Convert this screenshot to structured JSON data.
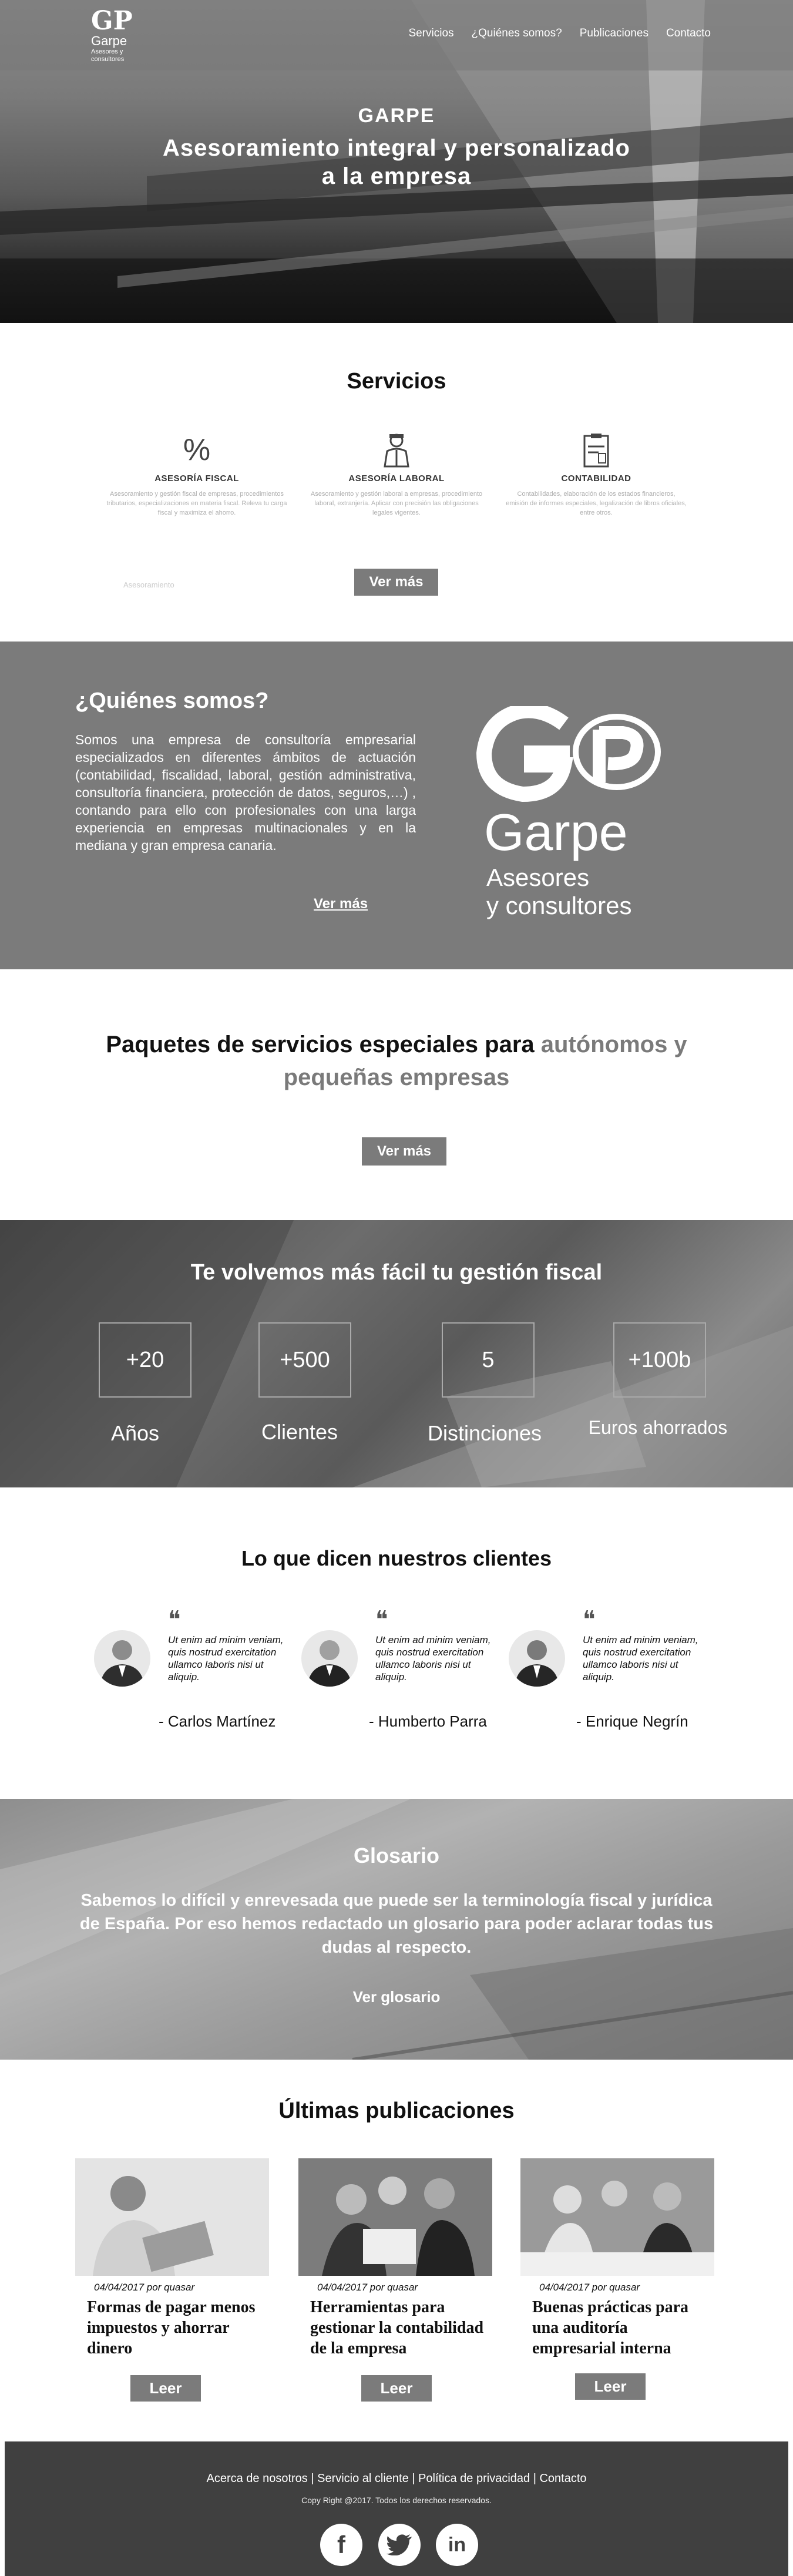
{
  "nav": {
    "logo_mark": "GP",
    "logo_name": "Garpe",
    "logo_sub": "Asesores y consultores",
    "links": [
      "Servicios",
      "¿Quiénes somos?",
      "Publicaciones",
      "Contacto"
    ]
  },
  "hero": {
    "title": "GARPE",
    "subtitle": "Asesoramiento integral y personalizado a la empresa"
  },
  "servicios": {
    "title": "Servicios",
    "items": [
      {
        "icon": "percent-icon",
        "title": "ASESORÍA FISCAL",
        "text": "Asesoramiento y gestión fiscal de empresas, procedimientos tributarios, especializaciones en materia fiscal. Releva tu carga fiscal y maximiza el ahorro."
      },
      {
        "icon": "worker-icon",
        "title": "ASESORÍA LABORAL",
        "text": "Asesoramiento y gestión laboral a empresas, procedimiento laboral, extranjería. Aplicar con precisión las obligaciones legales vigentes."
      },
      {
        "icon": "clipboard-icon",
        "title": "CONTABILIDAD",
        "text": "Contabilidades, elaboración de los estados financieros, emisión de informes especiales, legalización de libros oficiales, entre otros."
      }
    ],
    "faint_label": "Asesoramiento",
    "button": "Ver más"
  },
  "quienes": {
    "title": "¿Quiénes somos?",
    "text": "Somos una empresa de consultoría empresarial especializados en diferentes ámbitos de actuación (contabilidad, fiscalidad, laboral, gestión administrativa, consultoría financiera, protección de datos, seguros,…) , contando para ello con profesionales con una larga experiencia en empresas multinacionales y en la mediana y gran empresa canaria.",
    "link": "Ver más",
    "logo_name": "Garpe",
    "logo_sub_1": "Asesores",
    "logo_sub_2": "y consultores"
  },
  "paquetes": {
    "title_part1": "Paquetes de servicios especiales para ",
    "title_part2": "autónomos y pequeñas empresas",
    "button": "Ver más"
  },
  "fiscal": {
    "title": "Te volvemos más fácil tu gestión fiscal",
    "stats": [
      {
        "value": "+20",
        "label": "Años"
      },
      {
        "value": "+500",
        "label": "Clientes"
      },
      {
        "value": "5",
        "label": "Distinciones"
      },
      {
        "value": "+100b",
        "label": "Euros ahorrados"
      }
    ]
  },
  "testimonios": {
    "title": "Lo que dicen nuestros clientes",
    "items": [
      {
        "quote": "Ut enim ad minim veniam, quis nostrud exercitation ullamco laboris nisi ut aliquip.",
        "name": "- Carlos Martínez"
      },
      {
        "quote": "Ut enim ad minim veniam, quis nostrud exercitation ullamco laboris nisi ut aliquip.",
        "name": "- Humberto Parra"
      },
      {
        "quote": "Ut enim ad minim veniam, quis nostrud exercitation ullamco laboris nisi ut aliquip.",
        "name": "- Enrique Negrín"
      }
    ]
  },
  "glosario": {
    "title": "Glosario",
    "text": "Sabemos lo difícil y enrevesada que puede ser la terminología fiscal y jurídica de España. Por eso hemos redactado un glosario para poder aclarar todas tus dudas al respecto.",
    "link": "Ver glosario"
  },
  "publicaciones": {
    "title": "Últimas publicaciones",
    "items": [
      {
        "meta": "04/04/2017 por quasar",
        "title": "Formas de pagar menos impuestos y ahorrar dinero",
        "button": "Leer"
      },
      {
        "meta": "04/04/2017 por quasar",
        "title": "Herramientas para gestionar la contabilidad de la empresa",
        "button": "Leer"
      },
      {
        "meta": "04/04/2017 por quasar",
        "title": "Buenas prácticas para una auditoría empresarial interna",
        "button": "Leer"
      }
    ]
  },
  "footer": {
    "links": "Acerca de nosotros |  Servicio al cliente |  Política de privacidad | Contacto",
    "copy": "Copy Right @2017. Todos los derechos reservados.",
    "social": [
      "f",
      "t",
      "in"
    ]
  }
}
